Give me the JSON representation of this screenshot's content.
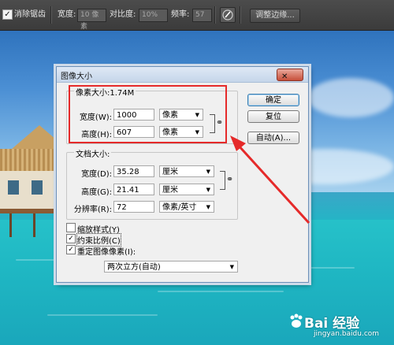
{
  "options_bar": {
    "anti_alias_label": "消除锯齿",
    "width_label": "宽度:",
    "width_value": "10 像素",
    "contrast_label": "对比度:",
    "contrast_value": "10%",
    "frequency_label": "频率:",
    "frequency_value": "57",
    "refine_edge_button": "调整边缘..."
  },
  "dialog": {
    "title": "图像大小",
    "close_glyph": "✕",
    "buttons": {
      "ok": "确定",
      "reset": "复位",
      "auto": "自动(A)..."
    },
    "pixel_dimensions": {
      "legend": "像素大小:1.74M",
      "width_label": "宽度(W):",
      "width_value": "1000",
      "width_unit": "像素",
      "height_label": "高度(H):",
      "height_value": "607",
      "height_unit": "像素"
    },
    "document_size": {
      "legend": "文档大小:",
      "width_label": "宽度(D):",
      "width_value": "35.28",
      "width_unit": "厘米",
      "height_label": "高度(G):",
      "height_value": "21.41",
      "height_unit": "厘米",
      "resolution_label": "分辨率(R):",
      "resolution_value": "72",
      "resolution_unit": "像素/英寸"
    },
    "options": {
      "scale_styles": {
        "label": "缩放样式(Y)",
        "checked": false
      },
      "constrain_proportions": {
        "label": "约束比例(C)",
        "checked": true
      },
      "resample_image": {
        "label": "重定图像像素(I):",
        "checked": true
      },
      "resample_method": "两次立方(自动)"
    },
    "check_glyph": "✓",
    "dropdown_glyph": "▼",
    "link_glyph": "⚭"
  },
  "watermark": {
    "logo": "Bai 经验",
    "url": "jingyan.baidu.com"
  },
  "colors": {
    "annotation": "#e52a2a",
    "dialog_bg": "#f0f0f0"
  },
  "icons": [
    "checkbox-checked-icon",
    "brush-icon",
    "close-icon",
    "chain-link-icon",
    "dropdown-arrow-icon",
    "annotation-arrow-icon",
    "baidu-paw-icon"
  ]
}
